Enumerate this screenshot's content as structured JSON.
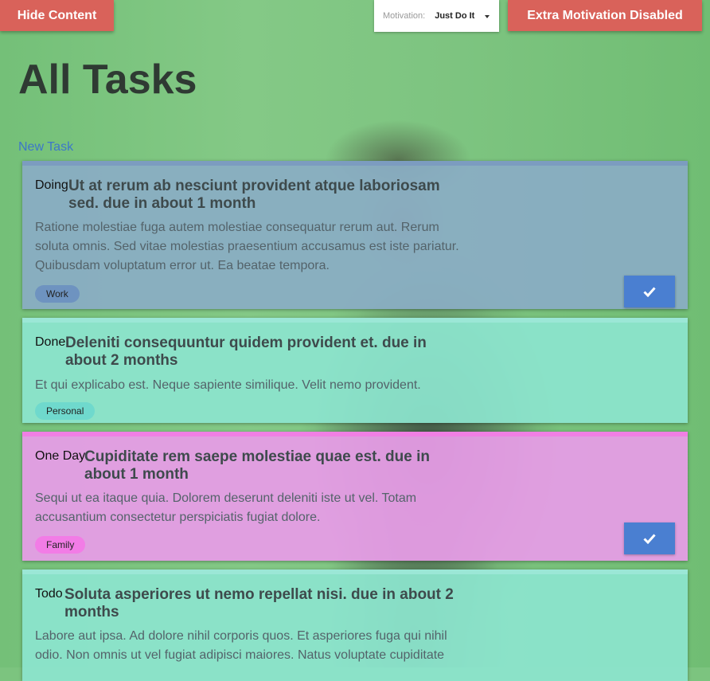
{
  "header": {
    "hide_label": "Hide Content",
    "motivation_label": "Motivation:",
    "motivation_value": "Just Do It",
    "extra_label": "Extra Motivation Disabled"
  },
  "page": {
    "title": "All Tasks",
    "new_task": "New Task"
  },
  "tasks": [
    {
      "status": "Doing",
      "title": "Ut at rerum ab nesciunt provident atque laboriosam sed. due in about 1 month",
      "description": "Ratione molestiae fuga autem molestiae consequatur rerum aut. Rerum soluta omnis. Sed vitae molestias praesentium accusamus est iste pariatur. Quibusdam voluptatum error ut. Ea beatae tempora.",
      "tag": "Work",
      "tag_color": "#6e93c0",
      "has_check": true
    },
    {
      "status": "Done",
      "title": "Deleniti consequuntur quidem provident et. due in about 2 months",
      "description": "Et qui explicabo est. Neque sapiente similique. Velit nemo provident.",
      "tag": "Personal",
      "tag_color": "#6fd9cd",
      "has_check": false
    },
    {
      "status": "One Day",
      "title": "Cupiditate rem saepe molestiae quae est. due in about 1 month",
      "description": "Sequi ut ea itaque quia. Dolorem deserunt deleniti iste ut vel. Totam accusantium consectetur perspiciatis fugiat dolore.",
      "tag": "Family",
      "tag_color": "#f27ce6",
      "has_check": true
    },
    {
      "status": "Todo",
      "title": "Soluta asperiores ut nemo repellat nisi. due in about 2 months",
      "description": "Labore aut ipsa. Ad dolore nihil corporis quos. Et asperiores fuga qui nihil odio. Non omnis ut vel fugiat adipisci maiores. Natus voluptate cupiditate",
      "tag": "",
      "has_check": false
    }
  ],
  "colors": {
    "button_red": "#d9625a",
    "check_blue": "#4a7fd1",
    "link_blue": "#3d77c9"
  },
  "icons": {
    "check": "check-icon",
    "caret": "caret-down-icon"
  }
}
